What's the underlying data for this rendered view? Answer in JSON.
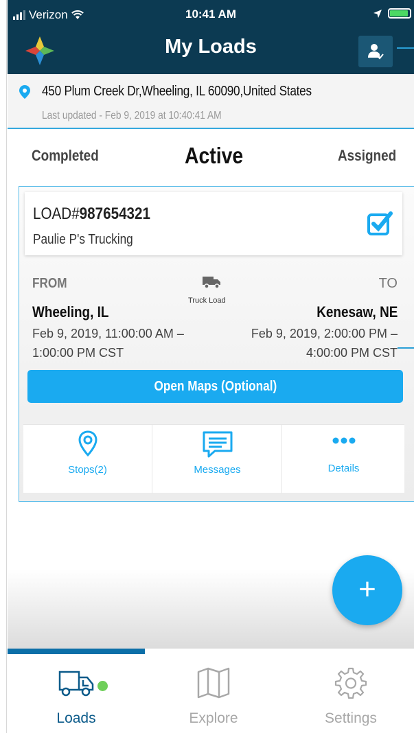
{
  "status_bar": {
    "carrier": "Verizon",
    "time": "10:41 AM"
  },
  "header": {
    "title": "My Loads",
    "brand_color": "#0c3a52"
  },
  "location": {
    "address": "450 Plum Creek Dr,Wheeling, IL  60090,United States",
    "last_updated": "Last updated - Feb 9, 2019 at 10:40:41 AM"
  },
  "tabs": [
    {
      "label": "Completed"
    },
    {
      "label": "Active",
      "selected": true
    },
    {
      "label": "Assigned"
    }
  ],
  "load": {
    "prefix": "LOAD#",
    "number": "987654321",
    "carrier": "Paulie P's Trucking",
    "checked": true,
    "from_label": "FROM",
    "to_label": "TO",
    "load_type": "Truck Load",
    "from_city": "Wheeling, IL",
    "to_city": "Kenesaw, NE",
    "from_time": "Feb 9, 2019, 11:00:00 AM – 1:00:00 PM CST",
    "to_time": "Feb 9, 2019, 2:00:00 PM – 4:00:00 PM CST",
    "maps_button": "Open Maps (Optional)",
    "actions": {
      "stops": "Stops(2)",
      "messages": "Messages",
      "details": "Details"
    }
  },
  "fab": {
    "label": "+"
  },
  "tabbar": {
    "items": [
      {
        "label": "Loads",
        "icon": "truck-icon",
        "active": true
      },
      {
        "label": "Explore",
        "icon": "map-icon"
      },
      {
        "label": "Settings",
        "icon": "gear-icon"
      }
    ]
  },
  "colors": {
    "accent": "#1aaaf0",
    "header": "#0c3a52",
    "active_tab": "#0c5b8a",
    "badge": "#6fcf5a"
  }
}
